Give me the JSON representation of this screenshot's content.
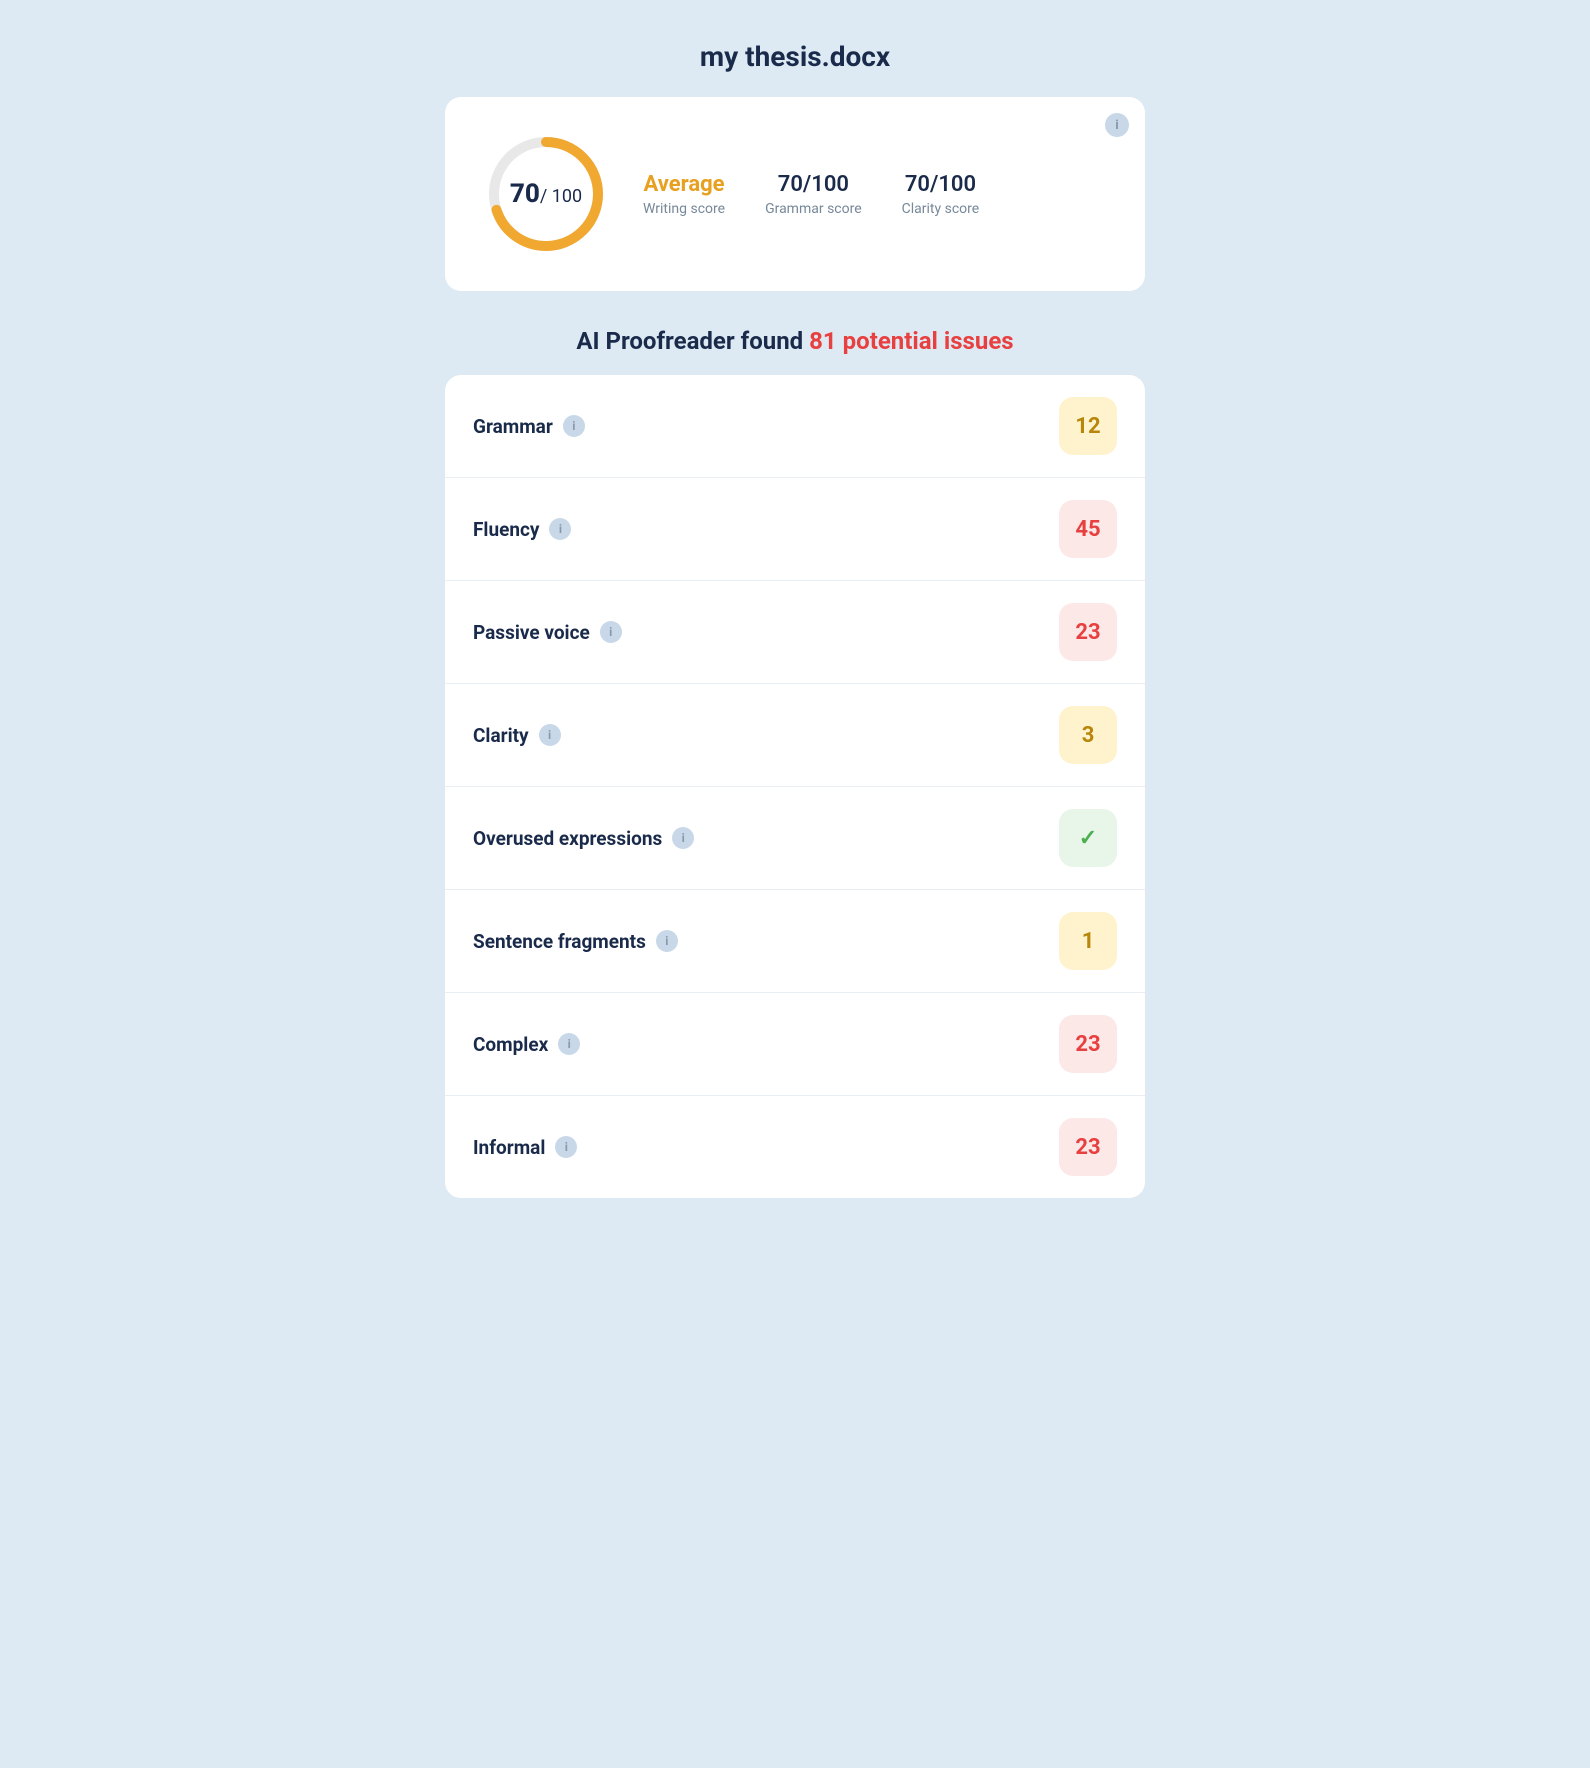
{
  "app": {
    "title": "my thesis.docx"
  },
  "scoreCard": {
    "score": "70",
    "total": "/ 100",
    "writingLabel": "Average",
    "writingSubLabel": "Writing score",
    "grammarValue": "70/100",
    "grammarSubLabel": "Grammar score",
    "clarityValue": "70/100",
    "claritySubLabel": "Clarity score",
    "infoIcon": "i",
    "donutPercent": 70,
    "donutTrackColor": "#e8e8e8",
    "donutFillColor": "#f0a830"
  },
  "proofreader": {
    "prefixText": "AI Proofreader found ",
    "issueCount": "81 potential issues"
  },
  "issues": [
    {
      "label": "Grammar",
      "value": "12",
      "badgeType": "yellow"
    },
    {
      "label": "Fluency",
      "value": "45",
      "badgeType": "red"
    },
    {
      "label": "Passive voice",
      "value": "23",
      "badgeType": "red"
    },
    {
      "label": "Clarity",
      "value": "3",
      "badgeType": "yellow"
    },
    {
      "label": "Overused expressions",
      "value": "✓",
      "badgeType": "green"
    },
    {
      "label": "Sentence fragments",
      "value": "1",
      "badgeType": "yellow"
    },
    {
      "label": "Complex",
      "value": "23",
      "badgeType": "red"
    },
    {
      "label": "Informal",
      "value": "23",
      "badgeType": "red"
    }
  ],
  "ui": {
    "infoLabel": "i"
  }
}
